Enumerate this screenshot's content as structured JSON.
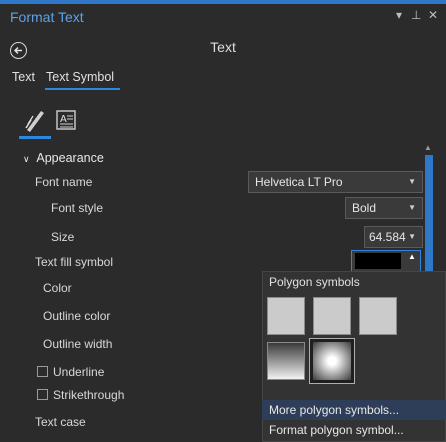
{
  "window": {
    "title": "Format Text",
    "controls": {
      "menu": "▾",
      "pin": "⊥",
      "close": "✕"
    }
  },
  "pane": {
    "title": "Text",
    "back_icon": "back-arrow-icon"
  },
  "tabs": [
    {
      "label": "Text",
      "active": false
    },
    {
      "label": "Text Symbol",
      "active": true
    }
  ],
  "icon_tabs": [
    {
      "icon": "pen-icon",
      "active": true
    },
    {
      "icon": "text-properties-icon",
      "active": false
    }
  ],
  "appearance": {
    "heading": "Appearance",
    "font_name": {
      "label": "Font name",
      "value": "Helvetica LT Pro"
    },
    "font_style": {
      "label": "Font style",
      "value": "Bold"
    },
    "size": {
      "label": "Size",
      "value": "64.5846"
    },
    "text_fill_symbol": {
      "label": "Text fill symbol",
      "color": "#000000"
    },
    "color_label": "Color",
    "outline_color_label": "Outline color",
    "outline_width_label": "Outline width",
    "underline": {
      "label": "Underline",
      "checked": false
    },
    "strikethrough": {
      "label": "Strikethrough",
      "checked": false
    },
    "text_case_label": "Text case"
  },
  "popup": {
    "title": "Polygon symbols",
    "swatches": [
      {
        "name": "gray-fill-1",
        "style": "solid-light-gray"
      },
      {
        "name": "gray-fill-2",
        "style": "solid-light-gray"
      },
      {
        "name": "gray-fill-3",
        "style": "solid-light-gray"
      },
      {
        "name": "gradient-linear",
        "style": "linear-gradient"
      },
      {
        "name": "gradient-radial",
        "style": "radial-gradient",
        "selected": true
      }
    ],
    "more_label": "More polygon symbols...",
    "format_label": "Format polygon symbol..."
  },
  "colors": {
    "accent": "#2e86de",
    "title_blue": "#5ba3e8",
    "background": "#2b2b2b",
    "popup_bg": "#333333",
    "highlight": "#2f3e58"
  }
}
